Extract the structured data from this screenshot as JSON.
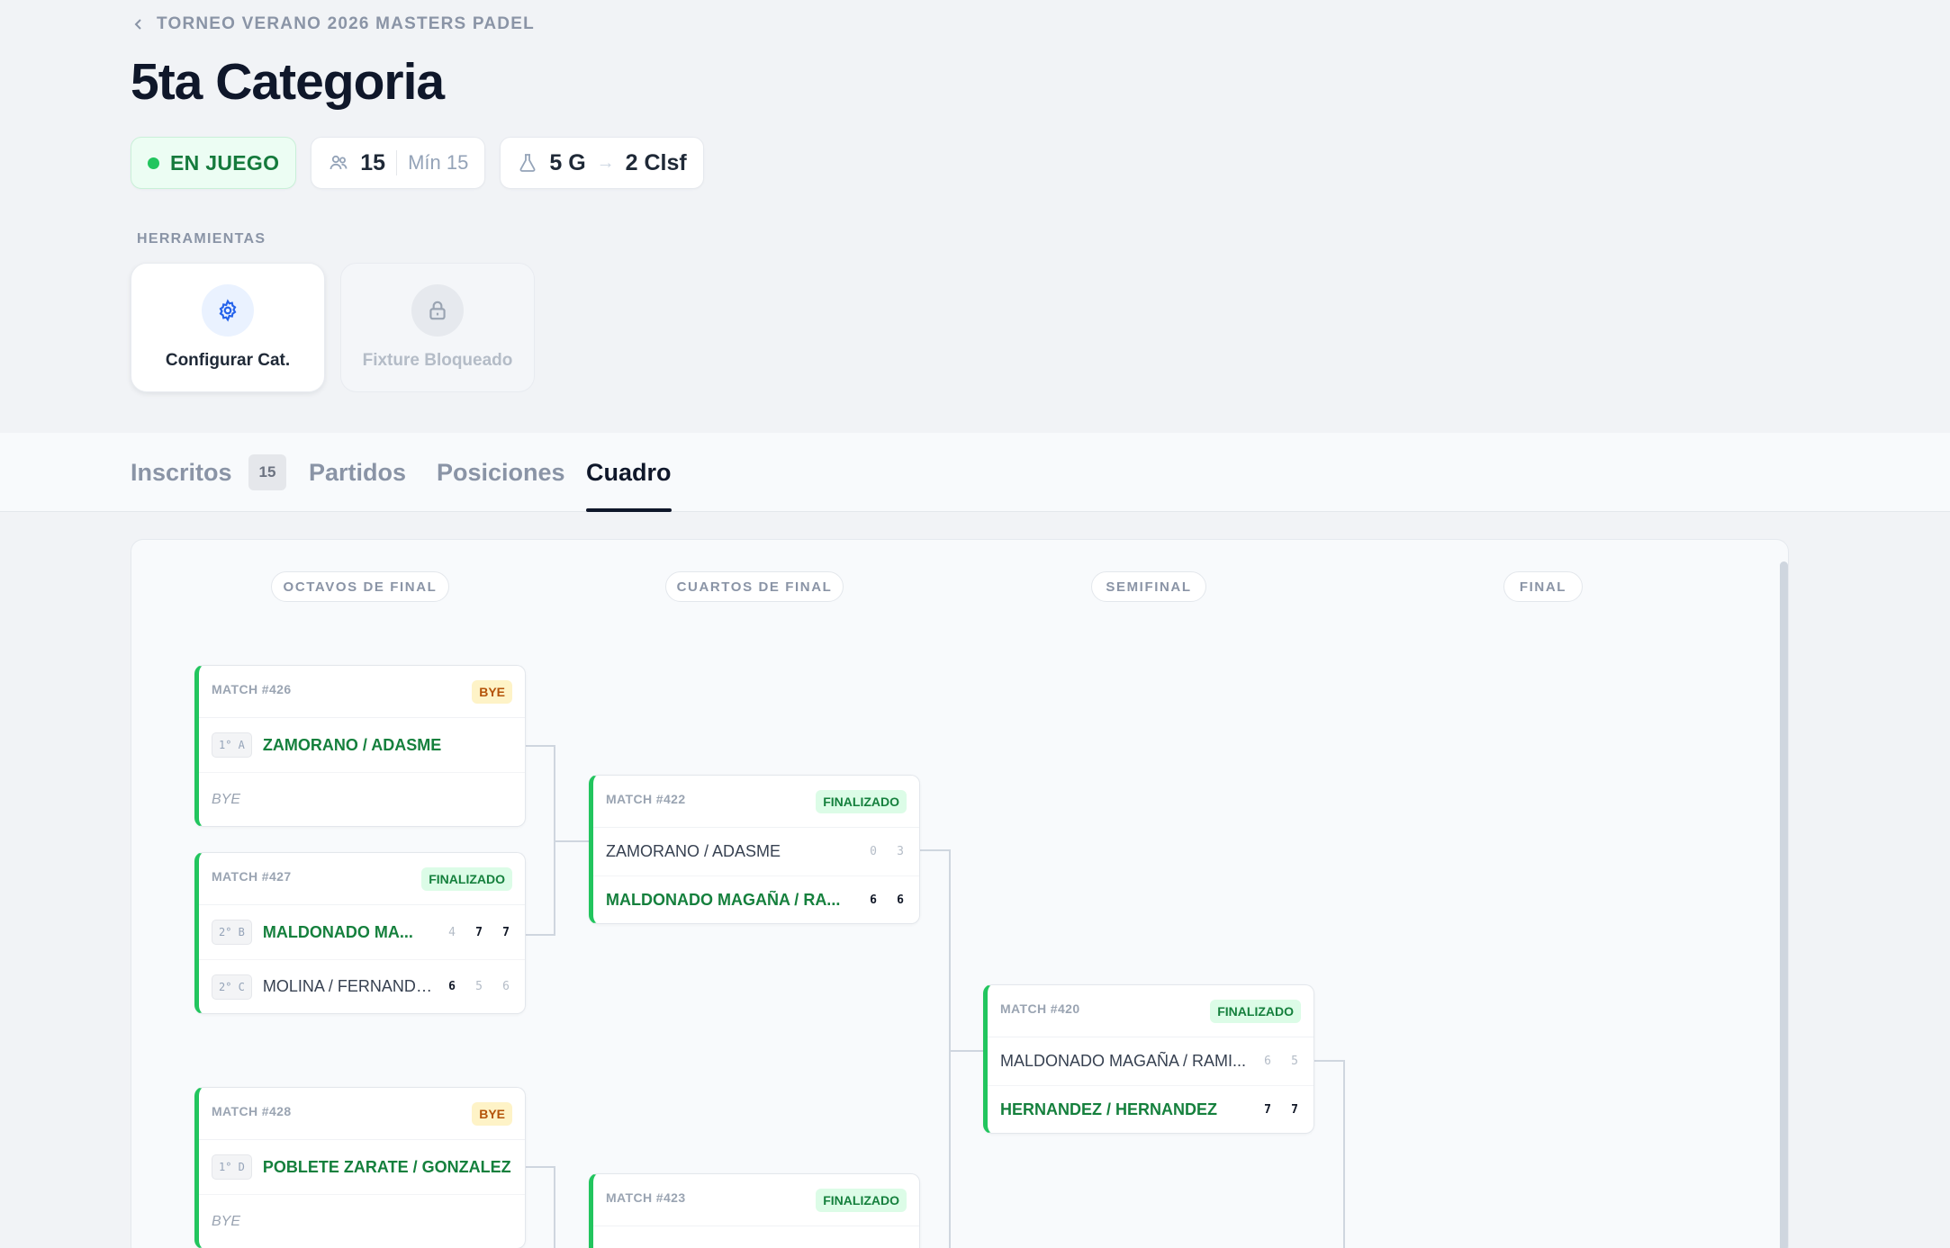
{
  "breadcrumb": "TORNEO VERANO 2026 MASTERS PADEL",
  "title": "5ta Categoria",
  "chips": {
    "status": "EN JUEGO",
    "players": "15",
    "min": "Mín 15",
    "groups": "5 G",
    "arrow": "→",
    "qualified": "2 Clsf"
  },
  "tools": {
    "label": "HERRAMIENTAS",
    "configure": "Configurar Cat.",
    "locked": "Fixture Bloqueado"
  },
  "tabs": [
    {
      "label": "Inscritos",
      "badge": "15"
    },
    {
      "label": "Partidos"
    },
    {
      "label": "Posiciones"
    },
    {
      "label": "Cuadro"
    }
  ],
  "rounds": [
    "OCTAVOS DE FINAL",
    "CUARTOS DE FINAL",
    "SEMIFINAL",
    "FINAL"
  ],
  "matches": {
    "m426": {
      "id": "MATCH #426",
      "status": "BYE",
      "teams": [
        {
          "seed": "1° A",
          "name": "ZAMORANO / ADASME"
        },
        {
          "name": "BYE"
        }
      ]
    },
    "m427": {
      "id": "MATCH #427",
      "status": "FINALIZADO",
      "teams": [
        {
          "seed": "2° B",
          "name": "MALDONADO MA...",
          "scores": [
            "4",
            "7",
            "7"
          ]
        },
        {
          "seed": "2° C",
          "name": "MOLINA / FERNANDEZ",
          "scores": [
            "6",
            "5",
            "6"
          ]
        }
      ]
    },
    "m428": {
      "id": "MATCH #428",
      "status": "BYE",
      "teams": [
        {
          "seed": "1° D",
          "name": "POBLETE ZARATE / GONZALEZ"
        },
        {
          "name": "BYE"
        }
      ]
    },
    "m422": {
      "id": "MATCH #422",
      "status": "FINALIZADO",
      "teams": [
        {
          "name": "ZAMORANO / ADASME",
          "scores": [
            "0",
            "3"
          ]
        },
        {
          "name": "MALDONADO MAGAÑA / RA...",
          "scores": [
            "6",
            "6"
          ]
        }
      ]
    },
    "m423": {
      "id": "MATCH #423",
      "status": "FINALIZADO"
    },
    "m420": {
      "id": "MATCH #420",
      "status": "FINALIZADO",
      "teams": [
        {
          "name": "MALDONADO MAGAÑA / RAMI...",
          "scores": [
            "6",
            "5"
          ]
        },
        {
          "name": "HERNANDEZ / HERNANDEZ",
          "scores": [
            "7",
            "7"
          ]
        }
      ]
    }
  },
  "colors": {
    "accent": "#22c55e",
    "win_text": "#15803d",
    "bye_badge": "#fef3c7",
    "finalizado_badge": "#dcfce7",
    "tool_icon": "#2563eb"
  }
}
